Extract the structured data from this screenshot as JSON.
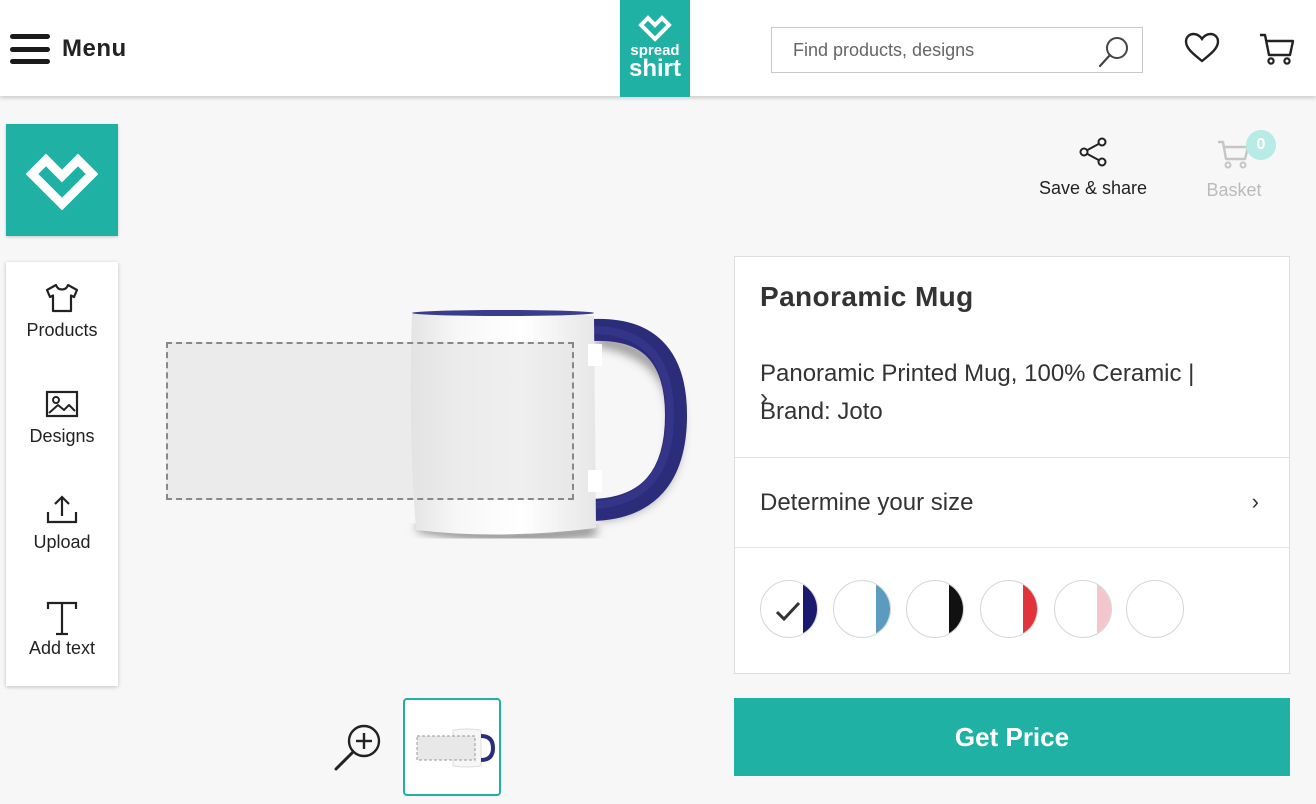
{
  "header": {
    "menu_label": "Menu",
    "logo_line1": "spread",
    "logo_line2": "shirt",
    "search_placeholder": "Find products, designs",
    "brand_color": "#1fb1a4"
  },
  "sidebar": {
    "items": [
      {
        "label": "Products",
        "icon": "tshirt-icon"
      },
      {
        "label": "Designs",
        "icon": "image-icon"
      },
      {
        "label": "Upload",
        "icon": "upload-icon"
      },
      {
        "label": "Add text",
        "icon": "text-icon"
      }
    ]
  },
  "actions": {
    "save_share_label": "Save & share",
    "basket_label": "Basket",
    "basket_count": "0"
  },
  "product": {
    "title": "Panoramic Mug",
    "description": "Panoramic Printed Mug, 100% Ceramic | Brand: Joto",
    "size_label": "Determine your size",
    "colors": [
      {
        "name": "white/navy",
        "accent": "#1a1a6e",
        "selected": true
      },
      {
        "name": "white/light blue",
        "accent": "#5b9bbf",
        "selected": false
      },
      {
        "name": "white/black",
        "accent": "#111111",
        "selected": false
      },
      {
        "name": "white/red",
        "accent": "#e0343a",
        "selected": false
      },
      {
        "name": "white/pink",
        "accent": "#f2c6cc",
        "selected": false
      },
      {
        "name": "white",
        "accent": "#ffffff",
        "selected": false
      }
    ]
  },
  "get_price_label": "Get Price"
}
